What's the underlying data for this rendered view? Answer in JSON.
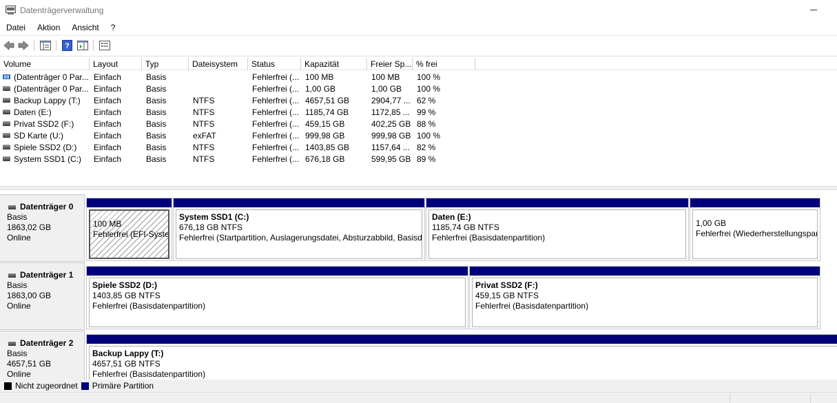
{
  "window": {
    "title": "Datenträgerverwaltung"
  },
  "menu": [
    "Datei",
    "Aktion",
    "Ansicht",
    "?"
  ],
  "toolbar": {
    "icons": [
      "back-icon",
      "forward-icon",
      "details-pane-icon",
      "help-icon",
      "properties-icon",
      "disk-list-icon"
    ]
  },
  "volume_list": {
    "columns": [
      "Volume",
      "Layout",
      "Typ",
      "Dateisystem",
      "Status",
      "Kapazität",
      "Freier Sp...",
      "% frei"
    ],
    "rows": [
      {
        "volume": "(Datenträger 0 Par...",
        "layout": "Einfach",
        "typ": "Basis",
        "dateisystem": "",
        "status": "Fehlerfrei (...",
        "kapazitaet": "100 MB",
        "frei": "100 MB",
        "prozent": "100 %",
        "icon": "efi-partition-icon"
      },
      {
        "volume": "(Datenträger 0 Par...",
        "layout": "Einfach",
        "typ": "Basis",
        "dateisystem": "",
        "status": "Fehlerfrei (...",
        "kapazitaet": "1,00 GB",
        "frei": "1,00 GB",
        "prozent": "100 %",
        "icon": "drive-icon"
      },
      {
        "volume": "Backup Lappy (T:)",
        "layout": "Einfach",
        "typ": "Basis",
        "dateisystem": "NTFS",
        "status": "Fehlerfrei (...",
        "kapazitaet": "4657,51 GB",
        "frei": "2904,77 ...",
        "prozent": "62 %",
        "icon": "drive-icon"
      },
      {
        "volume": "Daten (E:)",
        "layout": "Einfach",
        "typ": "Basis",
        "dateisystem": "NTFS",
        "status": "Fehlerfrei (...",
        "kapazitaet": "1185,74 GB",
        "frei": "1172,85 ...",
        "prozent": "99 %",
        "icon": "drive-icon"
      },
      {
        "volume": "Privat SSD2 (F:)",
        "layout": "Einfach",
        "typ": "Basis",
        "dateisystem": "NTFS",
        "status": "Fehlerfrei (...",
        "kapazitaet": "459,15 GB",
        "frei": "402,25 GB",
        "prozent": "88 %",
        "icon": "drive-icon"
      },
      {
        "volume": "SD Karte (U:)",
        "layout": "Einfach",
        "typ": "Basis",
        "dateisystem": "exFAT",
        "status": "Fehlerfrei (...",
        "kapazitaet": "999,98 GB",
        "frei": "999,98 GB",
        "prozent": "100 %",
        "icon": "drive-icon"
      },
      {
        "volume": "Spiele SSD2 (D:)",
        "layout": "Einfach",
        "typ": "Basis",
        "dateisystem": "NTFS",
        "status": "Fehlerfrei (...",
        "kapazitaet": "1403,85 GB",
        "frei": "1157,64 ...",
        "prozent": "82 %",
        "icon": "drive-icon"
      },
      {
        "volume": "System SSD1 (C:)",
        "layout": "Einfach",
        "typ": "Basis",
        "dateisystem": "NTFS",
        "status": "Fehlerfrei (...",
        "kapazitaet": "676,18 GB",
        "frei": "599,95 GB",
        "prozent": "89 %",
        "icon": "drive-icon"
      }
    ]
  },
  "disks": [
    {
      "name": "Datenträger 0",
      "type": "Basis",
      "size": "1863,02 GB",
      "state": "Online",
      "partitions": [
        {
          "name": "",
          "size": "100 MB",
          "status": "Fehlerfrei (EFI-Systempartition)",
          "hatched": true
        },
        {
          "name": "System SSD1  (C:)",
          "size": "676,18 GB NTFS",
          "status": "Fehlerfrei (Startpartition, Auslagerungsdatei, Absturzabbild, Basisdatenpartition)"
        },
        {
          "name": "Daten  (E:)",
          "size": "1185,74 GB NTFS",
          "status": "Fehlerfrei (Basisdatenpartition)"
        },
        {
          "name": "",
          "size": "1,00 GB",
          "status": "Fehlerfrei (Wiederherstellungspartition)"
        }
      ]
    },
    {
      "name": "Datenträger 1",
      "type": "Basis",
      "size": "1863,00 GB",
      "state": "Online",
      "partitions": [
        {
          "name": "Spiele SSD2  (D:)",
          "size": "1403,85 GB NTFS",
          "status": "Fehlerfrei (Basisdatenpartition)"
        },
        {
          "name": "Privat SSD2  (F:)",
          "size": "459,15 GB NTFS",
          "status": "Fehlerfrei (Basisdatenpartition)"
        }
      ]
    },
    {
      "name": "Datenträger 2",
      "type": "Basis",
      "size": "4657,51 GB",
      "state": "Online",
      "partitions": [
        {
          "name": "Backup Lappy  (T:)",
          "size": "4657,51 GB NTFS",
          "status": "Fehlerfrei (Basisdatenpartition)"
        }
      ]
    }
  ],
  "legend": [
    {
      "label": "Nicht zugeordnet",
      "color": "#000000"
    },
    {
      "label": "Primäre Partition",
      "color": "#00007b"
    }
  ],
  "colors": {
    "primary_partition": "#00007b",
    "unallocated": "#000000"
  }
}
